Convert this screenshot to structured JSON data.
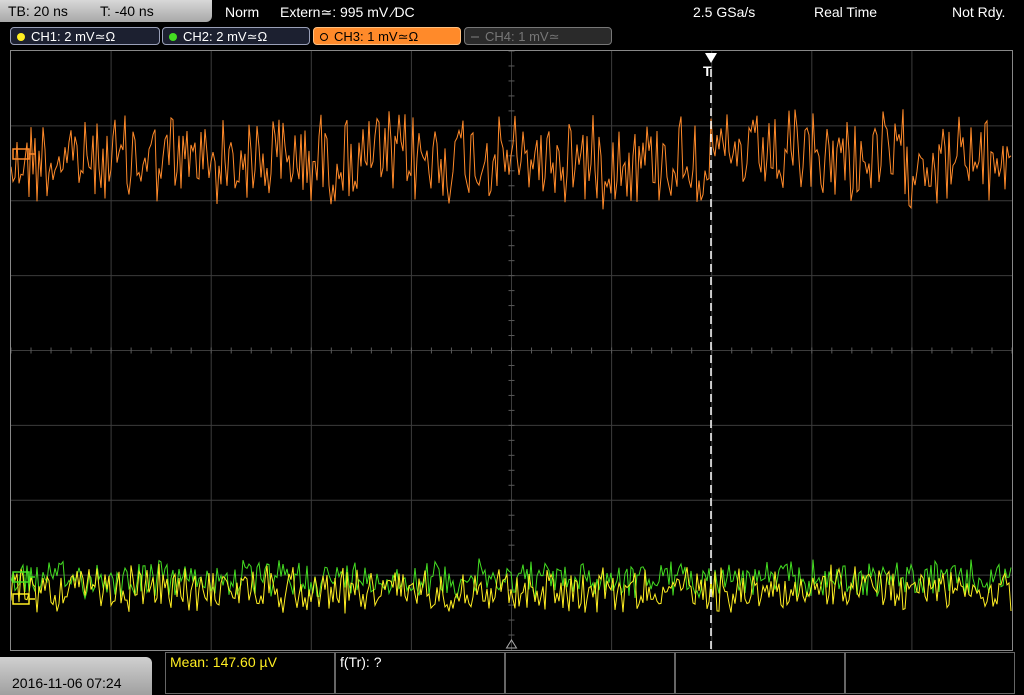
{
  "header": {
    "timebase": "TB: 20 ns",
    "trigger_offset": "T: -40 ns",
    "mode": "Norm",
    "trigger_source": "Extern≃: 995 mV ∕DC",
    "sample_rate": "2.5 GSa/s",
    "acquisition": "Real Time",
    "state": "Not Rdy."
  },
  "channels": [
    {
      "label": "CH1: 2 mV≃Ω",
      "color": "#ffee22"
    },
    {
      "label": "CH2: 2 mV≃Ω",
      "color": "#44dd22"
    },
    {
      "label": "CH3: 1 mV≃Ω",
      "color": "#ff8a2a"
    },
    {
      "label": "CH4: 1 mV≃",
      "color": "#666666"
    }
  ],
  "trigger_marker": "T",
  "footer": {
    "datetime": "2016-11-06 07:24",
    "measure1": "Mean: 147.60 µV",
    "measure2": "f(Tr): ?"
  },
  "colors": {
    "grid": "#3c3c3c",
    "ch1": "#ffee22",
    "ch2": "#44dd22",
    "ch3": "#ff8a2a",
    "trigger_line": "#ffffff"
  }
}
